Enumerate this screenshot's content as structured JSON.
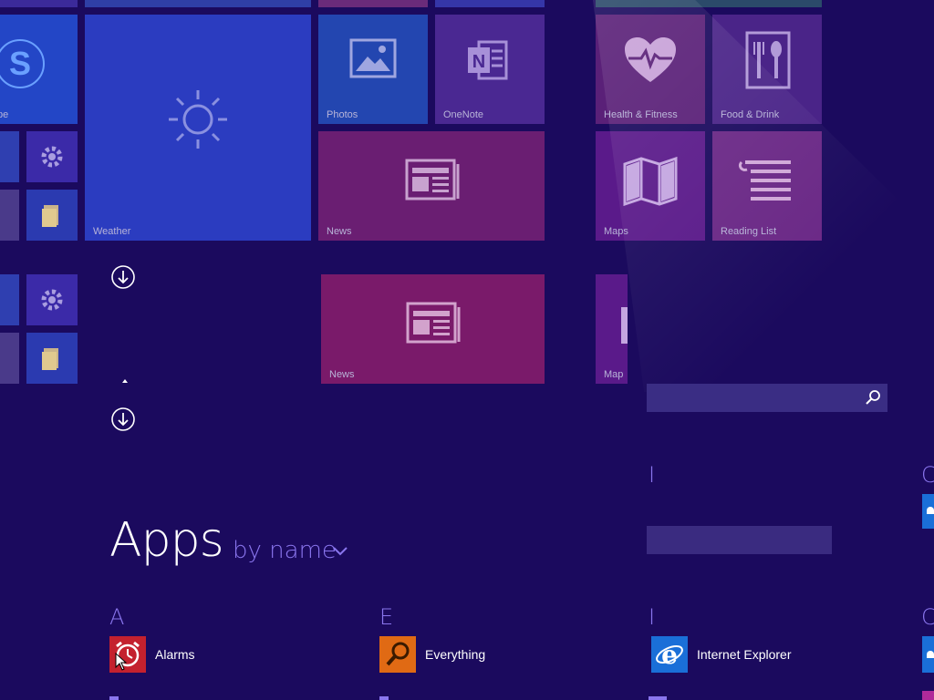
{
  "tiles": {
    "skype_label": "pe",
    "photos_label": "Photos",
    "onenote_label": "OneNote",
    "health_label": "Health & Fitness",
    "food_label": "Food & Drink",
    "weather_label": "Weather",
    "news_label": "News",
    "maps_label": "Maps",
    "reading_label": "Reading List",
    "news2_label": "News",
    "maps2_label": "Map"
  },
  "search": {
    "placeholder": "",
    "value": ""
  },
  "apps_header": {
    "title": "Apps",
    "sort_label": "by name"
  },
  "groups": {
    "a": "A",
    "e": "E",
    "i_top": "I",
    "i": "I",
    "c1": "C",
    "c2": "C"
  },
  "apps": {
    "alarms": "Alarms",
    "everything": "Everything",
    "internet_explorer": "Internet Explorer"
  },
  "colors": {
    "background": "#1b0a5e",
    "accent_letter": "#8a76ee",
    "alarms_icon": "#c4212e",
    "everything_icon": "#e06a14",
    "ie_icon": "#1a6fd8"
  },
  "icons": {
    "skype": "skype-icon",
    "settings": "gear-icon",
    "photos": "photos-icon",
    "onenote": "onenote-icon",
    "health": "heart-icon",
    "food": "fork-knife-icon",
    "weather": "sun-icon",
    "news": "newspaper-icon",
    "maps": "map-icon",
    "reading": "reading-list-icon",
    "search": "search-icon",
    "alarms": "alarm-clock-icon",
    "everything": "magnifier-icon",
    "ie": "internet-explorer-icon"
  }
}
